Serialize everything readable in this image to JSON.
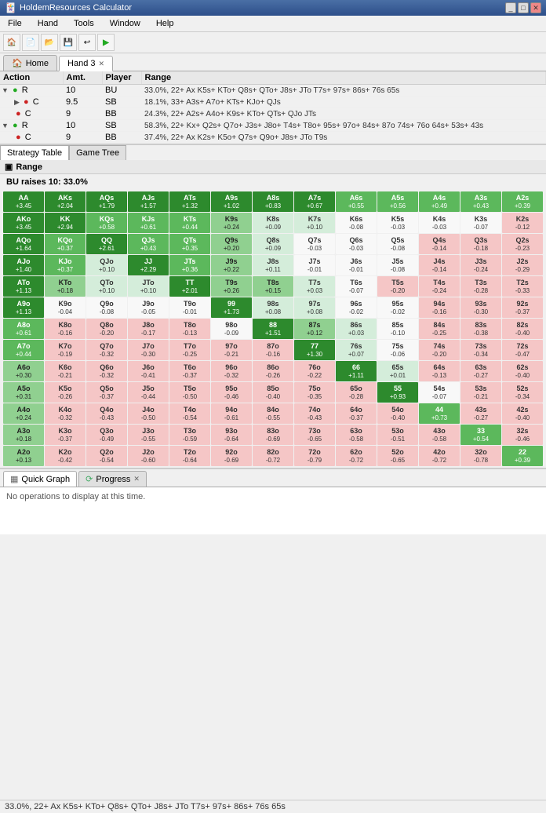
{
  "titleBar": {
    "title": "HoldemResources Calculator",
    "buttons": [
      "_",
      "□",
      "✕"
    ]
  },
  "menuBar": {
    "items": [
      "File",
      "Hand",
      "Tools",
      "Window",
      "Help"
    ]
  },
  "tabs": {
    "items": [
      {
        "label": "Home",
        "icon": "🏠",
        "active": false,
        "closable": false
      },
      {
        "label": "Hand 3",
        "icon": "",
        "active": true,
        "closable": true
      }
    ]
  },
  "treeTable": {
    "columns": [
      "Action",
      "Amt.",
      "Player",
      "Range"
    ],
    "rows": [
      {
        "indent": 0,
        "expanded": true,
        "type": "R",
        "dotColor": "green",
        "amt": "10",
        "player": "BU",
        "range": "33.0%, 22+ Ax K5s+ KTo+ Q8s+ QTo+ J8s+ JTo T7s+ 97s+ 86s+ 76s 65s",
        "hasChildren": true
      },
      {
        "indent": 1,
        "expanded": false,
        "type": "C",
        "dotColor": "red",
        "amt": "9.5",
        "player": "SB",
        "range": "18.1%, 33+ A3s+ A7o+ KTs+ KJo+ QJs",
        "hasChildren": true
      },
      {
        "indent": 1,
        "expanded": false,
        "type": "C",
        "dotColor": "red",
        "amt": "9",
        "player": "BB",
        "range": "24.3%, 22+ A2s+ A4o+ K9s+ KTo+ QTs+ QJo JTs",
        "hasChildren": false
      },
      {
        "indent": 0,
        "expanded": true,
        "type": "R",
        "dotColor": "green",
        "amt": "10",
        "player": "SB",
        "range": "58.3%, 22+ Kx+ Q2s+ Q7o+ J3s+ J8o+ T4s+ T8o+ 95s+ 97o+ 84s+ 87o 74s+ 76o 64s+ 53s+ 43s",
        "hasChildren": true
      },
      {
        "indent": 1,
        "expanded": false,
        "type": "C",
        "dotColor": "red",
        "amt": "9",
        "player": "BB",
        "range": "37.4%, 22+ Ax K2s+ K5o+ Q7s+ Q9o+ J8s+ JTo T9s",
        "hasChildren": false
      }
    ]
  },
  "strategyTabs": [
    "Strategy Table",
    "Game Tree"
  ],
  "rangePanel": {
    "title": "Range",
    "subtitle": "BU raises 10: 33.0%",
    "grid": [
      {
        "label": "AA",
        "val": "+3.45",
        "bg": "darkgreen"
      },
      {
        "label": "AKs",
        "val": "+2.04",
        "bg": "darkgreen"
      },
      {
        "label": "AQs",
        "val": "+1.79",
        "bg": "darkgreen"
      },
      {
        "label": "AJs",
        "val": "+1.57",
        "bg": "darkgreen"
      },
      {
        "label": "ATs",
        "val": "+1.32",
        "bg": "darkgreen"
      },
      {
        "label": "A9s",
        "val": "+1.02",
        "bg": "darkgreen"
      },
      {
        "label": "A8s",
        "val": "+0.83",
        "bg": "darkgreen"
      },
      {
        "label": "A7s",
        "val": "+0.67",
        "bg": "darkgreen"
      },
      {
        "label": "A6s",
        "val": "+0.55",
        "bg": "green"
      },
      {
        "label": "A5s",
        "val": "+0.56",
        "bg": "green"
      },
      {
        "label": "A4s",
        "val": "+0.49",
        "bg": "green"
      },
      {
        "label": "A3s",
        "val": "+0.43",
        "bg": "green"
      },
      {
        "label": "A2s",
        "val": "+0.39",
        "bg": "green"
      },
      {
        "label": "AKo",
        "val": "+3.45",
        "bg": "darkgreen"
      },
      {
        "label": "KK",
        "val": "+2.94",
        "bg": "darkgreen"
      },
      {
        "label": "KQs",
        "val": "+0.58",
        "bg": "green"
      },
      {
        "label": "KJs",
        "val": "+0.61",
        "bg": "green"
      },
      {
        "label": "KTs",
        "val": "+0.44",
        "bg": "green"
      },
      {
        "label": "K9s",
        "val": "+0.24",
        "bg": "lightgreen"
      },
      {
        "label": "K8s",
        "val": "+0.09",
        "bg": "palegreen"
      },
      {
        "label": "K7s",
        "val": "+0.10",
        "bg": "palegreen"
      },
      {
        "label": "K6s",
        "val": "-0.08",
        "bg": "white"
      },
      {
        "label": "K5s",
        "val": "-0.03",
        "bg": "white"
      },
      {
        "label": "K4s",
        "val": "-0.03",
        "bg": "white"
      },
      {
        "label": "K3s",
        "val": "-0.07",
        "bg": "white"
      },
      {
        "label": "K2s",
        "val": "-0.12",
        "bg": "pink"
      },
      {
        "label": "AQo",
        "val": "+1.64",
        "bg": "darkgreen"
      },
      {
        "label": "KQo",
        "val": "+0.37",
        "bg": "green"
      },
      {
        "label": "QQ",
        "val": "+2.61",
        "bg": "darkgreen"
      },
      {
        "label": "QJs",
        "val": "+0.43",
        "bg": "green"
      },
      {
        "label": "QTs",
        "val": "+0.35",
        "bg": "green"
      },
      {
        "label": "Q9s",
        "val": "+0.20",
        "bg": "lightgreen"
      },
      {
        "label": "Q8s",
        "val": "+0.09",
        "bg": "palegreen"
      },
      {
        "label": "Q7s",
        "val": "-0.03",
        "bg": "white"
      },
      {
        "label": "Q6s",
        "val": "-0.03",
        "bg": "white"
      },
      {
        "label": "Q5s",
        "val": "-0.08",
        "bg": "white"
      },
      {
        "label": "Q4s",
        "val": "-0.14",
        "bg": "pink"
      },
      {
        "label": "Q3s",
        "val": "-0.18",
        "bg": "pink"
      },
      {
        "label": "Q2s",
        "val": "-0.23",
        "bg": "pink"
      },
      {
        "label": "AJo",
        "val": "+1.40",
        "bg": "darkgreen"
      },
      {
        "label": "KJo",
        "val": "+0.37",
        "bg": "green"
      },
      {
        "label": "QJo",
        "val": "+0.10",
        "bg": "palegreen"
      },
      {
        "label": "JJ",
        "val": "+2.29",
        "bg": "darkgreen"
      },
      {
        "label": "JTs",
        "val": "+0.36",
        "bg": "green"
      },
      {
        "label": "J9s",
        "val": "+0.22",
        "bg": "lightgreen"
      },
      {
        "label": "J8s",
        "val": "+0.11",
        "bg": "palegreen"
      },
      {
        "label": "J7s",
        "val": "-0.01",
        "bg": "white"
      },
      {
        "label": "J6s",
        "val": "-0.01",
        "bg": "white"
      },
      {
        "label": "J5s",
        "val": "-0.08",
        "bg": "white"
      },
      {
        "label": "J4s",
        "val": "-0.14",
        "bg": "pink"
      },
      {
        "label": "J3s",
        "val": "-0.24",
        "bg": "pink"
      },
      {
        "label": "J2s",
        "val": "-0.29",
        "bg": "pink"
      },
      {
        "label": "ATo",
        "val": "+1.13",
        "bg": "darkgreen"
      },
      {
        "label": "KTo",
        "val": "+0.18",
        "bg": "lightgreen"
      },
      {
        "label": "QTo",
        "val": "+0.10",
        "bg": "palegreen"
      },
      {
        "label": "JTo",
        "val": "+0.10",
        "bg": "palegreen"
      },
      {
        "label": "TT",
        "val": "+2.01",
        "bg": "darkgreen"
      },
      {
        "label": "T9s",
        "val": "+0.26",
        "bg": "lightgreen"
      },
      {
        "label": "T8s",
        "val": "+0.15",
        "bg": "lightgreen"
      },
      {
        "label": "T7s",
        "val": "+0.03",
        "bg": "palegreen"
      },
      {
        "label": "T6s",
        "val": "-0.07",
        "bg": "white"
      },
      {
        "label": "T5s",
        "val": "-0.20",
        "bg": "pink"
      },
      {
        "label": "T4s",
        "val": "-0.24",
        "bg": "pink"
      },
      {
        "label": "T3s",
        "val": "-0.28",
        "bg": "pink"
      },
      {
        "label": "T2s",
        "val": "-0.33",
        "bg": "pink"
      },
      {
        "label": "A9o",
        "val": "+1.13",
        "bg": "darkgreen"
      },
      {
        "label": "K9o",
        "val": "-0.04",
        "bg": "white"
      },
      {
        "label": "Q9o",
        "val": "-0.08",
        "bg": "white"
      },
      {
        "label": "J9o",
        "val": "-0.05",
        "bg": "white"
      },
      {
        "label": "T9o",
        "val": "-0.01",
        "bg": "white"
      },
      {
        "label": "99",
        "val": "+1.73",
        "bg": "darkgreen"
      },
      {
        "label": "98s",
        "val": "+0.08",
        "bg": "palegreen"
      },
      {
        "label": "97s",
        "val": "+0.08",
        "bg": "palegreen"
      },
      {
        "label": "96s",
        "val": "-0.02",
        "bg": "white"
      },
      {
        "label": "95s",
        "val": "-0.02",
        "bg": "white"
      },
      {
        "label": "94s",
        "val": "-0.16",
        "bg": "pink"
      },
      {
        "label": "93s",
        "val": "-0.30",
        "bg": "pink"
      },
      {
        "label": "92s",
        "val": "-0.37",
        "bg": "pink"
      },
      {
        "label": "A8o",
        "val": "+0.61",
        "bg": "green"
      },
      {
        "label": "K8o",
        "val": "-0.16",
        "bg": "pink"
      },
      {
        "label": "Q8o",
        "val": "-0.20",
        "bg": "pink"
      },
      {
        "label": "J8o",
        "val": "-0.17",
        "bg": "pink"
      },
      {
        "label": "T8o",
        "val": "-0.13",
        "bg": "pink"
      },
      {
        "label": "98o",
        "val": "-0.09",
        "bg": "white"
      },
      {
        "label": "88",
        "val": "+1.51",
        "bg": "darkgreen"
      },
      {
        "label": "87s",
        "val": "+0.12",
        "bg": "lightgreen"
      },
      {
        "label": "86s",
        "val": "+0.03",
        "bg": "palegreen"
      },
      {
        "label": "85s",
        "val": "-0.10",
        "bg": "white"
      },
      {
        "label": "84s",
        "val": "-0.25",
        "bg": "pink"
      },
      {
        "label": "83s",
        "val": "-0.38",
        "bg": "pink"
      },
      {
        "label": "82s",
        "val": "-0.40",
        "bg": "pink"
      },
      {
        "label": "A7o",
        "val": "+0.44",
        "bg": "green"
      },
      {
        "label": "K7o",
        "val": "-0.19",
        "bg": "pink"
      },
      {
        "label": "Q7o",
        "val": "-0.32",
        "bg": "pink"
      },
      {
        "label": "J7o",
        "val": "-0.30",
        "bg": "pink"
      },
      {
        "label": "T7o",
        "val": "-0.25",
        "bg": "pink"
      },
      {
        "label": "97o",
        "val": "-0.21",
        "bg": "pink"
      },
      {
        "label": "87o",
        "val": "-0.16",
        "bg": "pink"
      },
      {
        "label": "77",
        "val": "+1.30",
        "bg": "darkgreen"
      },
      {
        "label": "76s",
        "val": "+0.07",
        "bg": "palegreen"
      },
      {
        "label": "75s",
        "val": "-0.06",
        "bg": "white"
      },
      {
        "label": "74s",
        "val": "-0.20",
        "bg": "pink"
      },
      {
        "label": "73s",
        "val": "-0.34",
        "bg": "pink"
      },
      {
        "label": "72s",
        "val": "-0.47",
        "bg": "pink"
      },
      {
        "label": "A6o",
        "val": "+0.30",
        "bg": "lightgreen"
      },
      {
        "label": "K6o",
        "val": "-0.21",
        "bg": "pink"
      },
      {
        "label": "Q6o",
        "val": "-0.32",
        "bg": "pink"
      },
      {
        "label": "J6o",
        "val": "-0.41",
        "bg": "pink"
      },
      {
        "label": "T6o",
        "val": "-0.37",
        "bg": "pink"
      },
      {
        "label": "96o",
        "val": "-0.32",
        "bg": "pink"
      },
      {
        "label": "86o",
        "val": "-0.26",
        "bg": "pink"
      },
      {
        "label": "76o",
        "val": "-0.22",
        "bg": "pink"
      },
      {
        "label": "66",
        "val": "+1.11",
        "bg": "darkgreen"
      },
      {
        "label": "65s",
        "val": "+0.01",
        "bg": "palegreen"
      },
      {
        "label": "64s",
        "val": "-0.13",
        "bg": "pink"
      },
      {
        "label": "63s",
        "val": "-0.27",
        "bg": "pink"
      },
      {
        "label": "62s",
        "val": "-0.40",
        "bg": "pink"
      },
      {
        "label": "A5o",
        "val": "+0.31",
        "bg": "lightgreen"
      },
      {
        "label": "K5o",
        "val": "-0.26",
        "bg": "pink"
      },
      {
        "label": "Q5o",
        "val": "-0.37",
        "bg": "pink"
      },
      {
        "label": "J5o",
        "val": "-0.44",
        "bg": "pink"
      },
      {
        "label": "T5o",
        "val": "-0.50",
        "bg": "pink"
      },
      {
        "label": "95o",
        "val": "-0.46",
        "bg": "pink"
      },
      {
        "label": "85o",
        "val": "-0.40",
        "bg": "pink"
      },
      {
        "label": "75o",
        "val": "-0.35",
        "bg": "pink"
      },
      {
        "label": "65o",
        "val": "-0.28",
        "bg": "pink"
      },
      {
        "label": "55",
        "val": "+0.93",
        "bg": "darkgreen"
      },
      {
        "label": "54s",
        "val": "-0.07",
        "bg": "white"
      },
      {
        "label": "53s",
        "val": "-0.21",
        "bg": "pink"
      },
      {
        "label": "52s",
        "val": "-0.34",
        "bg": "pink"
      },
      {
        "label": "A4o",
        "val": "+0.24",
        "bg": "lightgreen"
      },
      {
        "label": "K4o",
        "val": "-0.32",
        "bg": "pink"
      },
      {
        "label": "Q4o",
        "val": "-0.43",
        "bg": "pink"
      },
      {
        "label": "J4o",
        "val": "-0.50",
        "bg": "pink"
      },
      {
        "label": "T4o",
        "val": "-0.54",
        "bg": "pink"
      },
      {
        "label": "94o",
        "val": "-0.61",
        "bg": "pink"
      },
      {
        "label": "84o",
        "val": "-0.55",
        "bg": "pink"
      },
      {
        "label": "74o",
        "val": "-0.43",
        "bg": "pink"
      },
      {
        "label": "64o",
        "val": "-0.37",
        "bg": "pink"
      },
      {
        "label": "54o",
        "val": "-0.40",
        "bg": "pink"
      },
      {
        "label": "44",
        "val": "+0.73",
        "bg": "green"
      },
      {
        "label": "43s",
        "val": "-0.27",
        "bg": "pink"
      },
      {
        "label": "42s",
        "val": "-0.40",
        "bg": "pink"
      },
      {
        "label": "A3o",
        "val": "+0.18",
        "bg": "lightgreen"
      },
      {
        "label": "K3o",
        "val": "-0.37",
        "bg": "pink"
      },
      {
        "label": "Q3o",
        "val": "-0.49",
        "bg": "pink"
      },
      {
        "label": "J3o",
        "val": "-0.55",
        "bg": "pink"
      },
      {
        "label": "T3o",
        "val": "-0.59",
        "bg": "pink"
      },
      {
        "label": "93o",
        "val": "-0.64",
        "bg": "pink"
      },
      {
        "label": "83o",
        "val": "-0.69",
        "bg": "pink"
      },
      {
        "label": "73o",
        "val": "-0.65",
        "bg": "pink"
      },
      {
        "label": "63o",
        "val": "-0.58",
        "bg": "pink"
      },
      {
        "label": "53o",
        "val": "-0.51",
        "bg": "pink"
      },
      {
        "label": "43o",
        "val": "-0.58",
        "bg": "pink"
      },
      {
        "label": "33",
        "val": "+0.54",
        "bg": "green"
      },
      {
        "label": "32s",
        "val": "-0.46",
        "bg": "pink"
      },
      {
        "label": "A2o",
        "val": "+0.13",
        "bg": "lightgreen"
      },
      {
        "label": "K2o",
        "val": "-0.42",
        "bg": "pink"
      },
      {
        "label": "Q2o",
        "val": "-0.54",
        "bg": "pink"
      },
      {
        "label": "J2o",
        "val": "-0.60",
        "bg": "pink"
      },
      {
        "label": "T2o",
        "val": "-0.64",
        "bg": "pink"
      },
      {
        "label": "92o",
        "val": "-0.69",
        "bg": "pink"
      },
      {
        "label": "82o",
        "val": "-0.72",
        "bg": "pink"
      },
      {
        "label": "72o",
        "val": "-0.79",
        "bg": "pink"
      },
      {
        "label": "62o",
        "val": "-0.72",
        "bg": "pink"
      },
      {
        "label": "52o",
        "val": "-0.65",
        "bg": "pink"
      },
      {
        "label": "42o",
        "val": "-0.72",
        "bg": "pink"
      },
      {
        "label": "32o",
        "val": "-0.78",
        "bg": "pink"
      },
      {
        "label": "22",
        "val": "+0.39",
        "bg": "green"
      }
    ]
  },
  "bottomTabs": [
    {
      "label": "Quick Graph",
      "icon": "chart",
      "active": true,
      "closable": false
    },
    {
      "label": "Progress",
      "icon": "progress",
      "active": false,
      "closable": true
    }
  ],
  "progressText": "No operations to display at this time.",
  "statusBar": "33.0%, 22+ Ax K5s+ KTo+ Q8s+ QTo+ J8s+ JTo T7s+ 97s+ 86s+ 76s 65s"
}
